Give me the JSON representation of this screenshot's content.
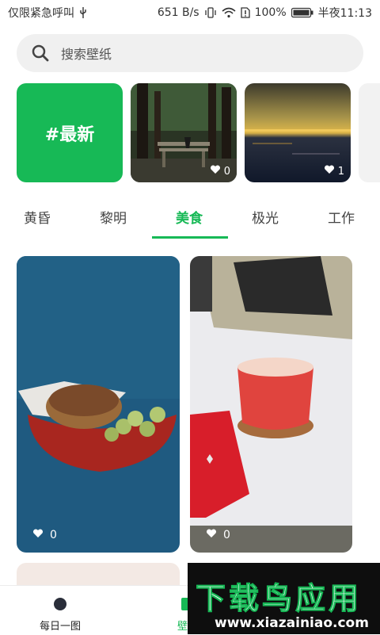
{
  "status_bar": {
    "carrier": "仅限紧急呼叫",
    "usb_icon": "usb-icon",
    "net_speed": "651 B/s",
    "battery": "100%",
    "time": "半夜11:13"
  },
  "search": {
    "placeholder": "搜索壁纸",
    "icon": "search-icon"
  },
  "featured": {
    "latest_label": "#最新",
    "items": [
      {
        "likes": "0"
      },
      {
        "likes": "1"
      }
    ]
  },
  "tabs": {
    "items": [
      {
        "label": "黄昏"
      },
      {
        "label": "黎明"
      },
      {
        "label": "美食"
      },
      {
        "label": "极光"
      },
      {
        "label": "工作"
      }
    ],
    "active_index": 2
  },
  "grid": {
    "items": [
      {
        "likes": "0"
      },
      {
        "likes": "0"
      }
    ]
  },
  "bottom_nav": {
    "items": [
      {
        "label": "每日一图"
      },
      {
        "label": "壁纸"
      }
    ]
  },
  "watermark": {
    "title": "下载鸟应用",
    "url": "www.xiazainiao.com"
  },
  "colors": {
    "accent": "#17b956",
    "search_bg": "#f0f0f0"
  }
}
